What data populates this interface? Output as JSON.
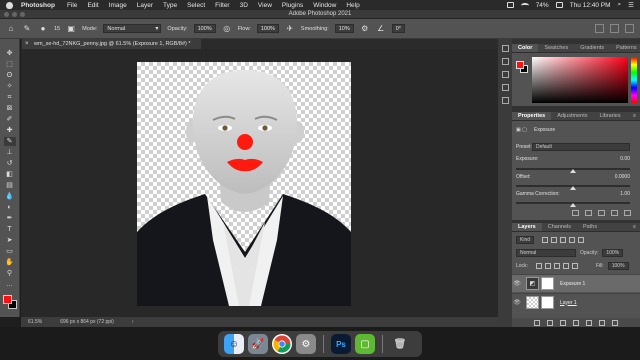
{
  "menubar": {
    "app_name": "Photoshop",
    "items": [
      "File",
      "Edit",
      "Image",
      "Layer",
      "Type",
      "Select",
      "Filter",
      "3D",
      "View",
      "Plugins",
      "Window",
      "Help"
    ],
    "battery": "74%",
    "clock": "Thu 12:40 PM"
  },
  "window": {
    "title": "Adobe Photoshop 2021"
  },
  "options": {
    "brush_size": "15",
    "mode_label": "Mode:",
    "mode_value": "Normal",
    "opacity_label": "Opacity:",
    "opacity_value": "100%",
    "flow_label": "Flow:",
    "flow_value": "100%",
    "smoothing_label": "Smoothing:",
    "smoothing_value": "10%",
    "angle_value": "0°"
  },
  "document": {
    "tab_title": "wm_se-hd_72NKG_penny.jpg @ 61.5% (Exposure 1, RGB/8#) *"
  },
  "status": {
    "zoom": "61.5%",
    "dimensions": "696 px x 864 px (72 ppi)"
  },
  "color_panel": {
    "tabs": [
      "Color",
      "Swatches",
      "Gradients",
      "Patterns"
    ],
    "foreground": "#ff1010",
    "background": "#000000"
  },
  "properties": {
    "tabs": [
      "Properties",
      "Adjustments",
      "Libraries"
    ],
    "adjustment_name": "Exposure",
    "preset_label": "Preset:",
    "preset_value": "Default",
    "exposure_label": "Exposure:",
    "exposure_value": "0.00",
    "offset_label": "Offset:",
    "offset_value": "0.0000",
    "gamma_label": "Gamma Correction:",
    "gamma_value": "1.00"
  },
  "layers_panel": {
    "tabs": [
      "Layers",
      "Channels",
      "Paths"
    ],
    "filter_kind": "Kind",
    "blend_mode": "Normal",
    "opacity_label": "Opacity:",
    "opacity_value": "100%",
    "lock_label": "Lock:",
    "fill_label": "Fill:",
    "fill_value": "100%",
    "layers": [
      "Exposure 1",
      "Layer 1"
    ]
  },
  "dock": {
    "apps": [
      "Finder",
      "Launchpad",
      "Chrome",
      "System Preferences",
      "Photoshop",
      "Camtasia",
      "Trash"
    ]
  }
}
